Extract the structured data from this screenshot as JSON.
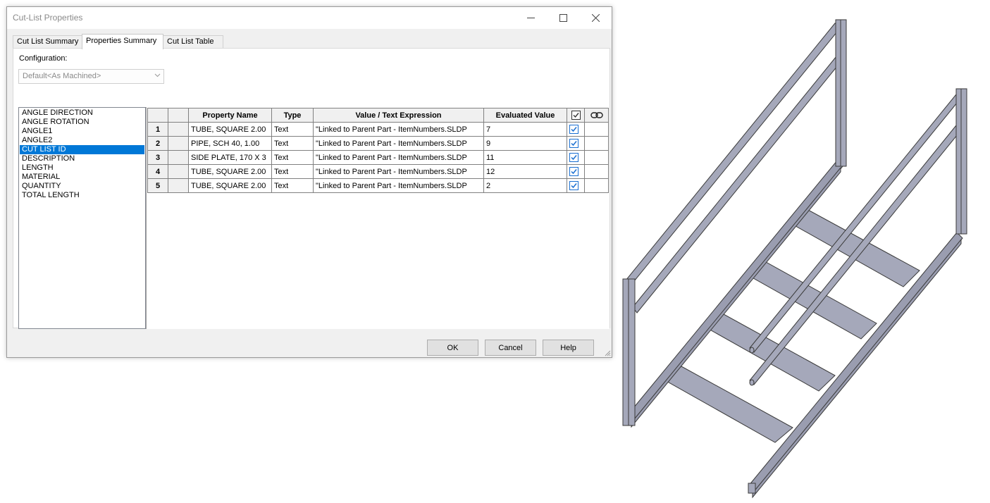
{
  "window": {
    "title": "Cut-List Properties",
    "minimize_glyph": "—",
    "maximize_glyph": "☐",
    "close_glyph": "✕"
  },
  "tabs": [
    {
      "label": "Cut List Summary",
      "active": false
    },
    {
      "label": "Properties Summary",
      "active": true
    },
    {
      "label": "Cut List Table",
      "active": false
    }
  ],
  "configuration": {
    "label": "Configuration:",
    "value": "Default<As Machined>"
  },
  "property_list": {
    "items": [
      "ANGLE DIRECTION",
      "ANGLE ROTATION",
      "ANGLE1",
      "ANGLE2",
      "CUT LIST ID",
      "DESCRIPTION",
      "LENGTH",
      "MATERIAL",
      "QUANTITY",
      "TOTAL LENGTH"
    ],
    "selected": "CUT LIST ID"
  },
  "grid": {
    "headers": {
      "property_name": "Property Name",
      "type": "Type",
      "value_expression": "Value / Text Expression",
      "evaluated_value": "Evaluated Value"
    },
    "rows": [
      {
        "num": "1",
        "name": "TUBE, SQUARE 2.00",
        "type": "Text",
        "expression": "\"Linked to Parent Part - ItemNumbers.SLDP",
        "evaluated": "7",
        "checked": true
      },
      {
        "num": "2",
        "name": "PIPE, SCH 40, 1.00",
        "type": "Text",
        "expression": "\"Linked to Parent Part - ItemNumbers.SLDP",
        "evaluated": "9",
        "checked": true
      },
      {
        "num": "3",
        "name": "SIDE PLATE, 170 X 3",
        "type": "Text",
        "expression": "\"Linked to Parent Part - ItemNumbers.SLDP",
        "evaluated": "11",
        "checked": true
      },
      {
        "num": "4",
        "name": "TUBE, SQUARE 2.00",
        "type": "Text",
        "expression": "\"Linked to Parent Part - ItemNumbers.SLDP",
        "evaluated": "12",
        "checked": true
      },
      {
        "num": "5",
        "name": "TUBE, SQUARE 2.00",
        "type": "Text",
        "expression": "\"Linked to Parent Part - ItemNumbers.SLDP",
        "evaluated": "2",
        "checked": true
      }
    ]
  },
  "buttons": {
    "ok": "OK",
    "cancel": "Cancel",
    "help": "Help"
  },
  "colors": {
    "selection": "#0078d7",
    "checkbox": "#1a6fd1",
    "model_gray": "#a5a8ba"
  }
}
